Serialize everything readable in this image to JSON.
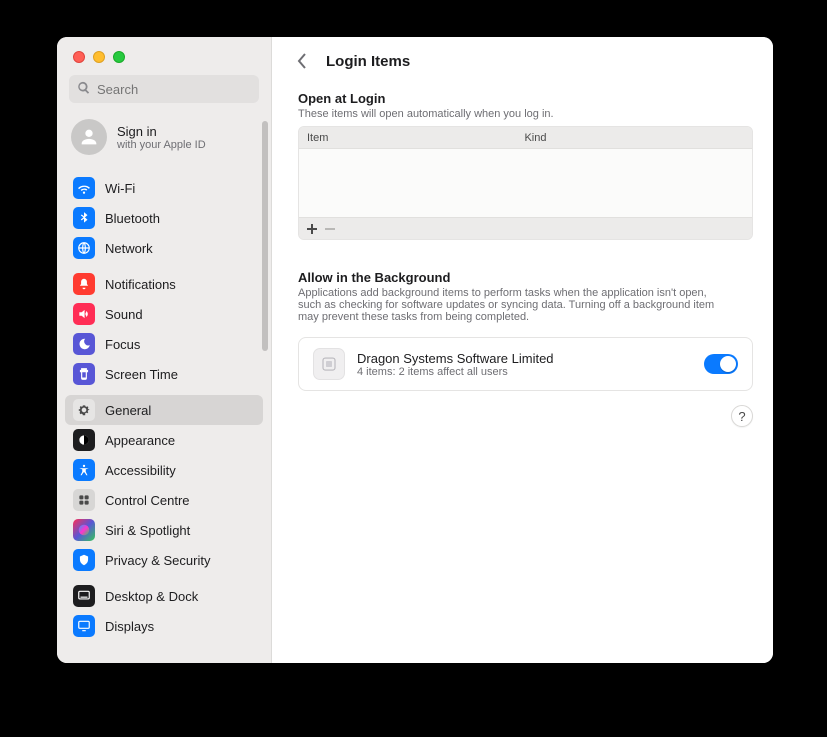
{
  "search": {
    "placeholder": "Search"
  },
  "account": {
    "title": "Sign in",
    "subtitle": "with your Apple ID"
  },
  "sidebar": {
    "groups": [
      {
        "items": [
          {
            "key": "wifi",
            "label": "Wi-Fi",
            "color": "#0a7aff"
          },
          {
            "key": "bluetooth",
            "label": "Bluetooth",
            "color": "#0a7aff"
          },
          {
            "key": "network",
            "label": "Network",
            "color": "#0a7aff"
          }
        ]
      },
      {
        "items": [
          {
            "key": "notifications",
            "label": "Notifications",
            "color": "#ff3b30"
          },
          {
            "key": "sound",
            "label": "Sound",
            "color": "#ff2d55"
          },
          {
            "key": "focus",
            "label": "Focus",
            "color": "#5856d6"
          },
          {
            "key": "screentime",
            "label": "Screen Time",
            "color": "#5856d6"
          }
        ]
      },
      {
        "items": [
          {
            "key": "general",
            "label": "General",
            "color": "#e6e5e4",
            "selected": true,
            "gray": true
          },
          {
            "key": "appearance",
            "label": "Appearance",
            "color": "#1d1d1f"
          },
          {
            "key": "accessibility",
            "label": "Accessibility",
            "color": "#0a7aff"
          },
          {
            "key": "controlcentre",
            "label": "Control Centre",
            "color": "#d7d6d5",
            "gray": true
          },
          {
            "key": "siri",
            "label": "Siri & Spotlight",
            "color": "#1d1d1f",
            "siri": true
          },
          {
            "key": "privacy",
            "label": "Privacy & Security",
            "color": "#0a7aff"
          }
        ]
      },
      {
        "items": [
          {
            "key": "desktopdock",
            "label": "Desktop & Dock",
            "color": "#1d1d1f"
          },
          {
            "key": "displays",
            "label": "Displays",
            "color": "#0a7aff"
          }
        ]
      }
    ]
  },
  "page": {
    "title": "Login Items",
    "open": {
      "heading": "Open at Login",
      "sub": "These items will open automatically when you log in.",
      "col_item": "Item",
      "col_kind": "Kind"
    },
    "bg": {
      "heading": "Allow in the Background",
      "sub": "Applications add background items to perform tasks when the application isn't open, such as checking for software updates or syncing data. Turning off a background item may prevent these tasks from being completed.",
      "items": [
        {
          "name": "Dragon Systems Software Limited",
          "detail": "4 items: 2 items affect all users",
          "on": true
        }
      ]
    },
    "help": "?"
  }
}
